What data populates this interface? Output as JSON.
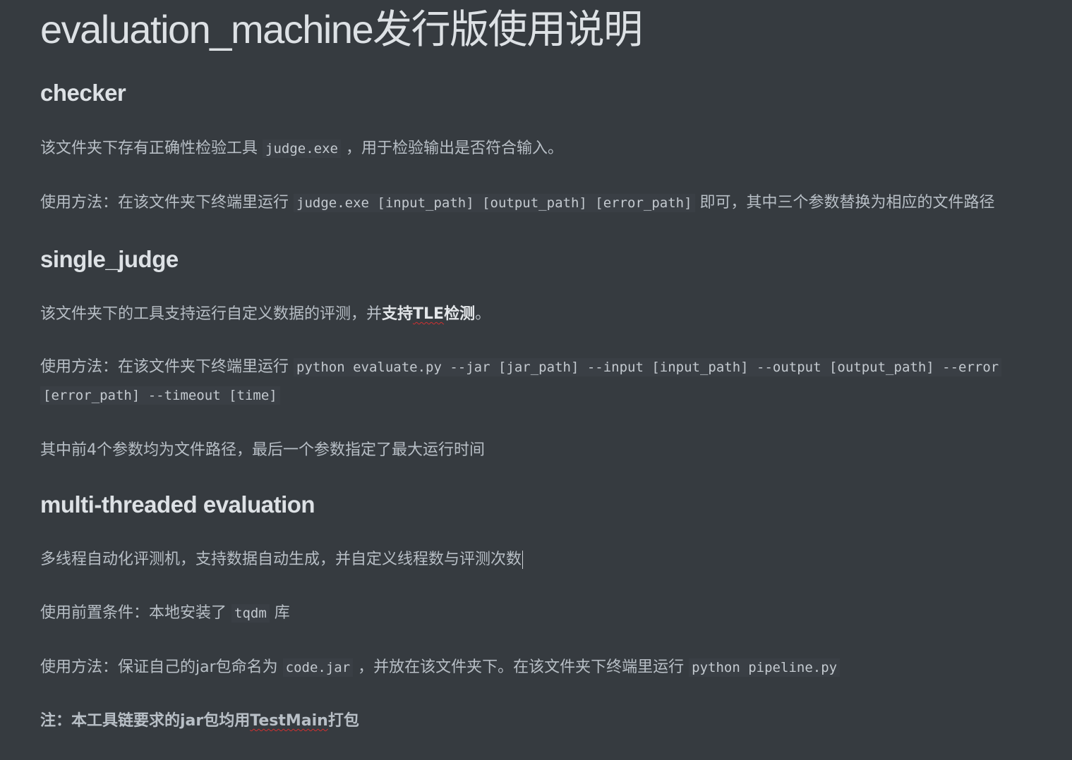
{
  "title": "evaluation_machine发行版使用说明",
  "checker": {
    "heading": "checker",
    "p1_pre": "该文件夹下存有正确性检验工具",
    "p1_code": "judge.exe",
    "p1_post": "，用于检验输出是否符合输入。",
    "p2_pre": "使用方法：在该文件夹下终端里运行",
    "p2_code": "judge.exe [input_path] [output_path] [error_path]",
    "p2_post": "即可，其中三个参数替换为相应的文件路径"
  },
  "single_judge": {
    "heading": "single_judge",
    "p1_pre": "该文件夹下的工具支持运行自定义数据的评测，并",
    "p1_bold_pre": "支持",
    "p1_bold_tle": "TLE",
    "p1_bold_post": "检测",
    "p1_post": "。",
    "p2_pre": "使用方法：在该文件夹下终端里运行",
    "p2_code_line1": "python evaluate.py --jar [jar_path] --input [input_path] --output [output_path] --error",
    "p2_code_line2": "[error_path] --timeout [time]",
    "p3": "其中前4个参数均为文件路径，最后一个参数指定了最大运行时间"
  },
  "multi": {
    "heading": "multi-threaded evaluation",
    "p1": "多线程自动化评测机，支持数据自动生成，并自定义线程数与评测次数",
    "p2_pre": "使用前置条件：本地安装了",
    "p2_code": "tqdm",
    "p2_post": "库",
    "p3_pre": "使用方法：保证自己的jar包命名为",
    "p3_code1": "code.jar",
    "p3_mid": "，并放在该文件夹下。在该文件夹下终端里运行",
    "p3_code2": "python pipeline.py",
    "note_pre": "注：本工具链要求的jar包均用",
    "note_word": "TestMain",
    "note_post": "打包"
  }
}
